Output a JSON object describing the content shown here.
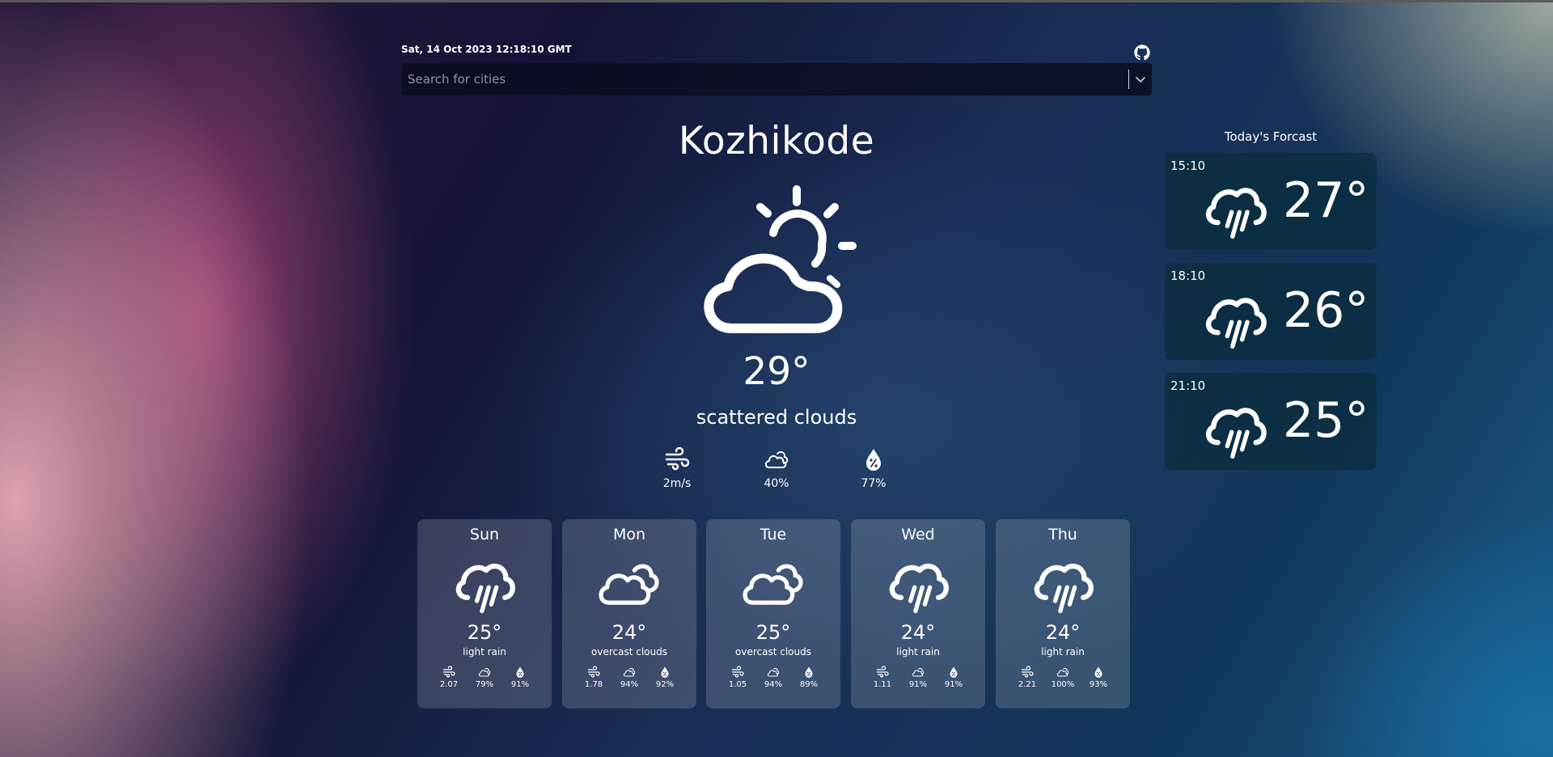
{
  "header": {
    "datetime": "Sat, 14 Oct 2023 12:18:10 GMT",
    "github_icon": "github-icon"
  },
  "search": {
    "placeholder": "Search for cities"
  },
  "current": {
    "city": "Kozhikode",
    "icon": "partly-cloudy-sun-icon",
    "temperature": "29°",
    "description": "scattered clouds",
    "wind": "2m/s",
    "clouds": "40%",
    "humidity": "77%"
  },
  "daily": [
    {
      "day": "Sun",
      "icon": "rain-icon",
      "temp": "25°",
      "desc": "light rain",
      "wind": "2.07",
      "clouds": "79%",
      "humidity": "91%"
    },
    {
      "day": "Mon",
      "icon": "clouds-icon",
      "temp": "24°",
      "desc": "overcast clouds",
      "wind": "1.78",
      "clouds": "94%",
      "humidity": "92%"
    },
    {
      "day": "Tue",
      "icon": "clouds-icon",
      "temp": "25°",
      "desc": "overcast clouds",
      "wind": "1.05",
      "clouds": "94%",
      "humidity": "89%"
    },
    {
      "day": "Wed",
      "icon": "rain-icon",
      "temp": "24°",
      "desc": "light rain",
      "wind": "1.11",
      "clouds": "91%",
      "humidity": "91%"
    },
    {
      "day": "Thu",
      "icon": "rain-icon",
      "temp": "24°",
      "desc": "light rain",
      "wind": "2.21",
      "clouds": "100%",
      "humidity": "93%"
    }
  ],
  "today": {
    "title": "Today's Forcast",
    "items": [
      {
        "time": "15:10",
        "icon": "rain-icon",
        "temp": "27°"
      },
      {
        "time": "18:10",
        "icon": "rain-icon",
        "temp": "26°"
      },
      {
        "time": "21:10",
        "icon": "rain-icon",
        "temp": "25°"
      }
    ]
  }
}
